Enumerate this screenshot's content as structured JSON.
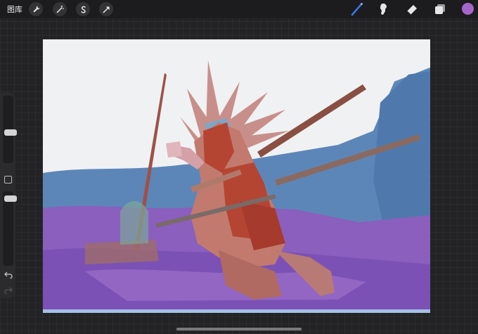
{
  "topbar": {
    "gallery_label": "图库",
    "left_tools": [
      "wrench-icon",
      "magic-wand-icon",
      "selection-s-icon",
      "transform-arrow-icon"
    ],
    "right_tools": [
      "brush-icon",
      "smudge-icon",
      "eraser-icon",
      "layers-icon"
    ],
    "active_tool": "brush-icon",
    "brush_color": "#3b74e6",
    "current_color": "#a566c9"
  },
  "sidebar": {
    "brush_size_level": 0.55,
    "opacity_level": 0.94,
    "controls": [
      "brush-size-slider",
      "modify-button",
      "opacity-slider",
      "undo-icon",
      "redo-icon"
    ]
  },
  "canvas": {
    "artwork": "digital-painting",
    "palette": {
      "sky": "#f0f1f3",
      "blue": "#5d86b8",
      "violet": "#8a5fbe",
      "figure_red": "#b54533",
      "figure_flesh": "#c27a6e",
      "staff": "#9c5248"
    }
  }
}
